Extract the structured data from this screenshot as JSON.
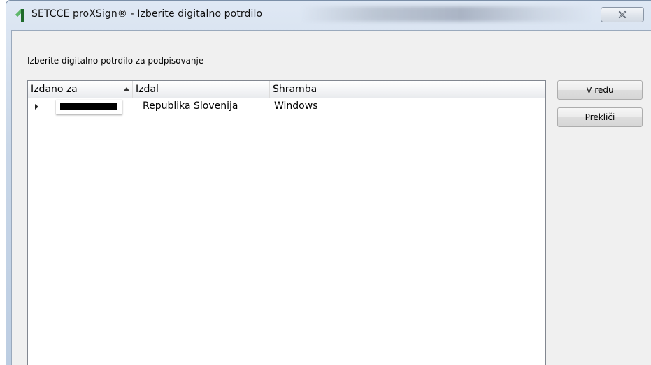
{
  "window": {
    "title": "SETCCE proXSign® - Izberite digitalno potrdilo",
    "icon": "setcce-app-icon",
    "close_icon": "close-icon"
  },
  "dialog": {
    "prompt": "Izberite digitalno potrdilo za podpisovanje",
    "columns": [
      "Izdano za",
      "Izdal",
      "Shramba"
    ],
    "sort_column": "Izdano za",
    "sort_direction": "ascending",
    "rows": [
      {
        "issued_to": "",
        "issued_to_redacted": true,
        "issuer": "Republika Slovenija",
        "store": "Windows",
        "expandable": true
      }
    ]
  },
  "buttons": {
    "ok": "V redu",
    "cancel": "Prekliči"
  },
  "colors": {
    "titlebar": "#c9d7e8",
    "client_bg": "#f0f0f0",
    "icon_green": "#2e8b3a"
  }
}
